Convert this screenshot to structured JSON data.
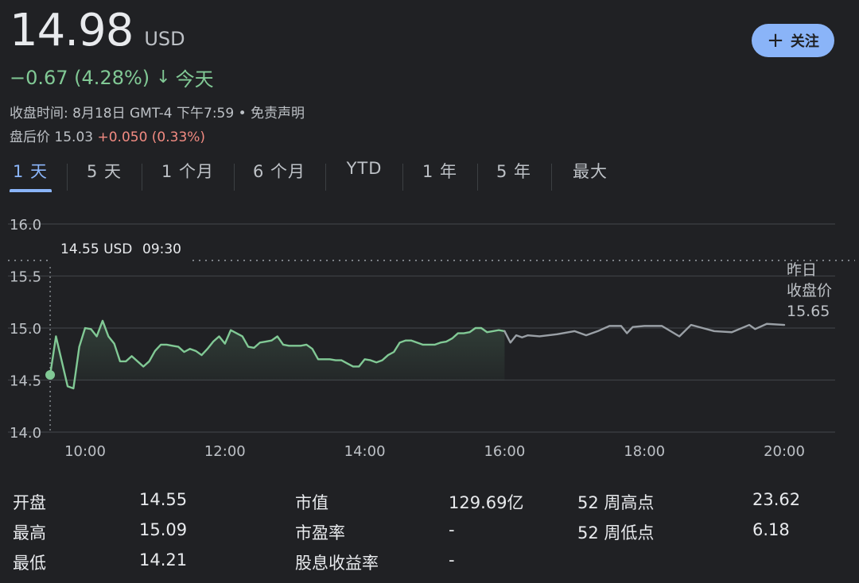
{
  "quote": {
    "price": "14.98",
    "currency": "USD",
    "change": "−0.67 (4.28%)",
    "change_arrow": "↓",
    "period": "今天",
    "close_time": "收盘时间: 8月18日 GMT-4 下午7:59 • 免责声明",
    "after_hours_label": "盘后价 15.03",
    "after_hours_change": "+0.050 (0.33%)"
  },
  "follow_button": {
    "icon": "plus-icon",
    "label": "关注"
  },
  "tabs": [
    {
      "label": "1 天",
      "active": true
    },
    {
      "label": "5 天"
    },
    {
      "label": "1 个月"
    },
    {
      "label": "6 个月"
    },
    {
      "label": "YTD"
    },
    {
      "label": "1 年"
    },
    {
      "label": "5 年"
    },
    {
      "label": "最大"
    }
  ],
  "chart_data": {
    "type": "line",
    "xlabel": "",
    "ylabel": "",
    "ylim": [
      14.0,
      16.0
    ],
    "xlim": [
      "09:30",
      "20:00"
    ],
    "y_ticks": [
      "16.0",
      "15.5",
      "15.0",
      "14.5",
      "14.0"
    ],
    "x_ticks": [
      "10:00",
      "12:00",
      "14:00",
      "16:00",
      "18:00",
      "20:00"
    ],
    "grid": true,
    "colors": {
      "regular": "#81c995",
      "after_hours": "#9aa0a6",
      "grid": "#3c4043",
      "reference": "#9aa0a6"
    },
    "tooltip": {
      "price": "14.55 USD",
      "time": "09:30"
    },
    "reference": {
      "label_lines": [
        "昨日",
        "收盘价",
        "15.65"
      ],
      "value": 15.65
    },
    "series": [
      {
        "segment": "regular",
        "x": [
          "09:30",
          "09:35",
          "09:40",
          "09:45",
          "09:50",
          "09:55",
          "10:00",
          "10:05",
          "10:10",
          "10:15",
          "10:20",
          "10:25",
          "10:30",
          "10:35",
          "10:40",
          "10:45",
          "10:50",
          "10:55",
          "11:00",
          "11:05",
          "11:10",
          "11:15",
          "11:20",
          "11:25",
          "11:30",
          "11:35",
          "11:40",
          "11:45",
          "11:50",
          "11:55",
          "12:00",
          "12:05",
          "12:10",
          "12:15",
          "12:20",
          "12:25",
          "12:30",
          "12:35",
          "12:40",
          "12:45",
          "12:50",
          "12:55",
          "13:00",
          "13:05",
          "13:10",
          "13:15",
          "13:20",
          "13:25",
          "13:30",
          "13:35",
          "13:40",
          "13:45",
          "13:50",
          "13:55",
          "14:00",
          "14:05",
          "14:10",
          "14:15",
          "14:20",
          "14:25",
          "14:30",
          "14:35",
          "14:40",
          "14:45",
          "14:50",
          "14:55",
          "15:00",
          "15:05",
          "15:10",
          "15:15",
          "15:20",
          "15:25",
          "15:30",
          "15:35",
          "15:40",
          "15:45",
          "15:50",
          "15:55",
          "16:00"
        ],
        "values": [
          14.55,
          14.92,
          14.68,
          14.44,
          14.42,
          14.82,
          15.0,
          14.99,
          14.92,
          15.07,
          14.92,
          14.85,
          14.68,
          14.68,
          14.73,
          14.68,
          14.63,
          14.68,
          14.78,
          14.84,
          14.84,
          14.83,
          14.82,
          14.77,
          14.8,
          14.78,
          14.74,
          14.8,
          14.87,
          14.92,
          14.85,
          14.98,
          14.95,
          14.92,
          14.82,
          14.81,
          14.86,
          14.87,
          14.88,
          14.92,
          14.84,
          14.83,
          14.83,
          14.83,
          14.84,
          14.8,
          14.7,
          14.7,
          14.7,
          14.69,
          14.69,
          14.66,
          14.63,
          14.63,
          14.7,
          14.69,
          14.67,
          14.69,
          14.74,
          14.77,
          14.86,
          14.88,
          14.88,
          14.86,
          14.84,
          14.84,
          14.84,
          14.86,
          14.87,
          14.9,
          14.95,
          14.95,
          14.96,
          15.0,
          15.0,
          14.96,
          14.97,
          14.98,
          14.97
        ]
      },
      {
        "segment": "after_hours",
        "x": [
          "16:00",
          "16:05",
          "16:10",
          "16:15",
          "16:20",
          "16:30",
          "16:45",
          "17:00",
          "17:10",
          "17:20",
          "17:30",
          "17:40",
          "17:45",
          "17:50",
          "18:00",
          "18:15",
          "18:30",
          "18:40",
          "18:50",
          "19:00",
          "19:15",
          "19:30",
          "19:35",
          "19:45",
          "20:00"
        ],
        "values": [
          14.97,
          14.86,
          14.93,
          14.91,
          14.93,
          14.92,
          14.94,
          14.97,
          14.93,
          14.97,
          15.02,
          15.02,
          14.95,
          15.01,
          15.02,
          15.02,
          14.92,
          15.03,
          15.0,
          14.97,
          14.96,
          15.03,
          14.99,
          15.04,
          15.03
        ]
      }
    ]
  },
  "stats": {
    "open_label": "开盘",
    "open_value": "14.55",
    "high_label": "最高",
    "high_value": "15.09",
    "low_label": "最低",
    "low_value": "14.21",
    "mktcap_label": "市值",
    "mktcap_value": "129.69亿",
    "pe_label": "市盈率",
    "pe_value": "-",
    "yield_label": "股息收益率",
    "yield_value": "-",
    "high52_label": "52 周高点",
    "high52_value": "23.62",
    "low52_label": "52 周低点",
    "low52_value": "6.18"
  }
}
